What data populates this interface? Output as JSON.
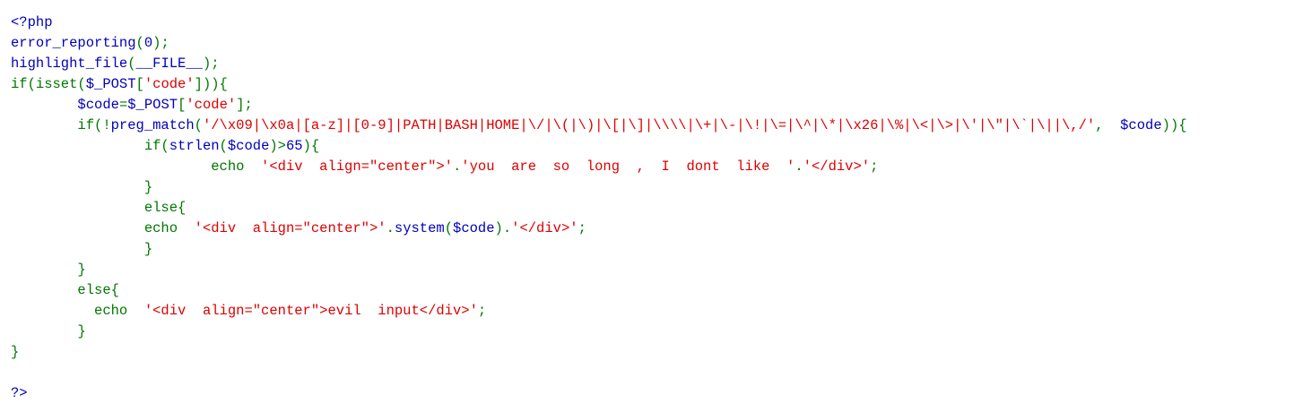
{
  "colors": {
    "default": "#0000BB",
    "keyword": "#007700",
    "string": "#DD0000",
    "background": "#FFFFFF"
  },
  "lines": [
    [
      [
        "default",
        "<?php"
      ]
    ],
    [
      [
        "default",
        "error_reporting"
      ],
      [
        "keyword",
        "("
      ],
      [
        "default",
        "0"
      ],
      [
        "keyword",
        ");"
      ]
    ],
    [
      [
        "default",
        "highlight_file"
      ],
      [
        "keyword",
        "("
      ],
      [
        "default",
        "__FILE__"
      ],
      [
        "keyword",
        ");"
      ]
    ],
    [
      [
        "keyword",
        "if(isset("
      ],
      [
        "default",
        "$_POST"
      ],
      [
        "keyword",
        "["
      ],
      [
        "string",
        "'code'"
      ],
      [
        "keyword",
        "])){"
      ]
    ],
    [
      [
        "keyword",
        "        "
      ],
      [
        "default",
        "$code"
      ],
      [
        "keyword",
        "="
      ],
      [
        "default",
        "$_POST"
      ],
      [
        "keyword",
        "["
      ],
      [
        "string",
        "'code'"
      ],
      [
        "keyword",
        "];"
      ]
    ],
    [
      [
        "keyword",
        "        if(!"
      ],
      [
        "default",
        "preg_match"
      ],
      [
        "keyword",
        "("
      ],
      [
        "string",
        "'/\\x09|\\x0a|[a-z]|[0-9]|PATH|BASH|HOME|\\/|\\(|\\)|\\[|\\]|\\\\\\\\|\\+|\\-|\\!|\\=|\\^|\\*|\\x26|\\%|\\<|\\>|\\'|\\\"|\\`|\\||\\,/'"
      ],
      [
        "keyword",
        ",  "
      ],
      [
        "default",
        "$code"
      ],
      [
        "keyword",
        ")){"
      ]
    ],
    [
      [
        "keyword",
        "                if("
      ],
      [
        "default",
        "strlen"
      ],
      [
        "keyword",
        "("
      ],
      [
        "default",
        "$code"
      ],
      [
        "keyword",
        ")>"
      ],
      [
        "default",
        "65"
      ],
      [
        "keyword",
        "){"
      ]
    ],
    [
      [
        "keyword",
        "                        echo  "
      ],
      [
        "string",
        "'<div  align=\"center\">'"
      ],
      [
        "keyword",
        "."
      ],
      [
        "string",
        "'you  are  so  long  ,  I  dont  like  '"
      ],
      [
        "keyword",
        "."
      ],
      [
        "string",
        "'</div>'"
      ],
      [
        "keyword",
        ";"
      ]
    ],
    [
      [
        "keyword",
        "                }"
      ]
    ],
    [
      [
        "keyword",
        "                else{"
      ]
    ],
    [
      [
        "keyword",
        "                echo  "
      ],
      [
        "string",
        "'<div  align=\"center\">'"
      ],
      [
        "keyword",
        "."
      ],
      [
        "default",
        "system"
      ],
      [
        "keyword",
        "("
      ],
      [
        "default",
        "$code"
      ],
      [
        "keyword",
        ")."
      ],
      [
        "string",
        "'</div>'"
      ],
      [
        "keyword",
        ";"
      ]
    ],
    [
      [
        "keyword",
        "                }"
      ]
    ],
    [
      [
        "keyword",
        "        }"
      ]
    ],
    [
      [
        "keyword",
        "        else{"
      ]
    ],
    [
      [
        "keyword",
        "          echo  "
      ],
      [
        "string",
        "'<div  align=\"center\">evil  input</div>'"
      ],
      [
        "keyword",
        ";"
      ]
    ],
    [
      [
        "keyword",
        "        }"
      ]
    ],
    [
      [
        "keyword",
        "}"
      ]
    ],
    [],
    [
      [
        "default",
        "?>"
      ]
    ]
  ]
}
